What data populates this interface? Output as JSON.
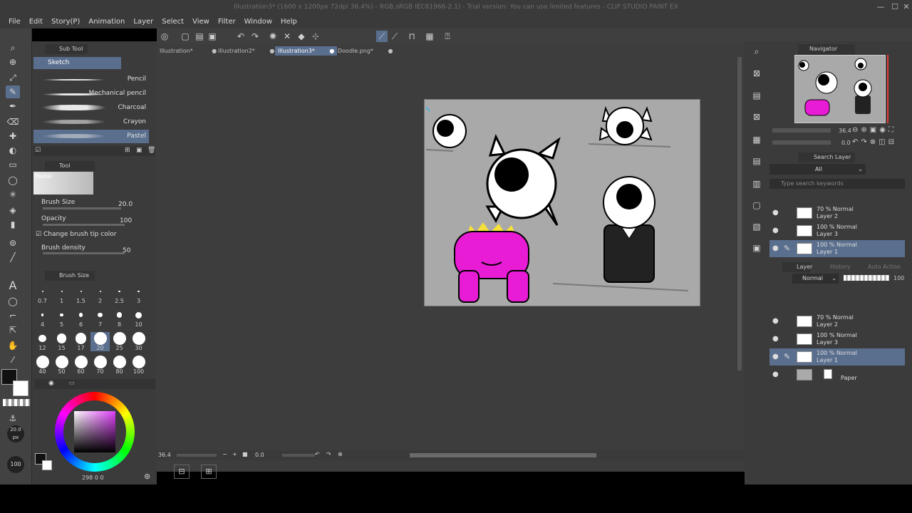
{
  "window": {
    "title": "Illustration3* (1600 x 1200px 72dpi 36.4%) - RGB,sRGB IEC61966-2.1) - Trial version: You can use limited features - CLIP STUDIO PAINT EX",
    "minimize": "—",
    "maximize": "☐",
    "close": "✕"
  },
  "menu": [
    "File",
    "Edit",
    "Story(P)",
    "Animation",
    "Layer",
    "Select",
    "View",
    "Filter",
    "Window",
    "Help"
  ],
  "tabs": [
    {
      "label": "Illustration*",
      "close": "●"
    },
    {
      "label": "Illustration2*",
      "close": "●"
    },
    {
      "label": "Illustration3*",
      "close": "●",
      "active": true
    },
    {
      "label": "Doodle.png*",
      "close": "●"
    }
  ],
  "subtool": {
    "title": "Sub Tool",
    "group": "Sketch",
    "brushes": [
      {
        "name": "Pencil"
      },
      {
        "name": "Mechanical pencil"
      },
      {
        "name": "Charcoal"
      },
      {
        "name": "Crayon"
      },
      {
        "name": "Pastel",
        "selected": true
      }
    ]
  },
  "toolprop": {
    "title": "Tool Property",
    "preview_label": "Pastel",
    "brush_size_label": "Brush Size",
    "brush_size_value": "20.0",
    "opacity_label": "Opacity",
    "opacity_value": "100",
    "change_tip_label": "Change brush tip color",
    "density_label": "Brush density",
    "density_value": "50"
  },
  "brushsize": {
    "title": "Brush Size",
    "sizes": [
      "0.7",
      "1",
      "1.5",
      "2",
      "2.5",
      "3",
      "4",
      "5",
      "6",
      "7",
      "8",
      "10",
      "12",
      "15",
      "17",
      "20",
      "25",
      "30",
      "40",
      "50",
      "60",
      "70",
      "80",
      "100"
    ],
    "selected": "20"
  },
  "sidebar_readouts": {
    "size": "20.0",
    "unit": "px",
    "opacity": "100"
  },
  "color": {
    "main": "#111111",
    "sub": "#ffffff",
    "bottom_readout": "298 0 0"
  },
  "canvas_status": {
    "zoom": "36.4",
    "angle": "0.0"
  },
  "navigator": {
    "title": "Navigator",
    "zoom": "36.4",
    "angle": "0.0"
  },
  "search_layer": {
    "title": "Search Layer",
    "filter": "All",
    "placeholder": "Type search keywords"
  },
  "layer_panel": {
    "tab_layer": "Layer",
    "tab_history": "History",
    "tab_auto": "Auto Action",
    "blend_mode": "Normal",
    "opacity": "100"
  },
  "layers_search": [
    {
      "line1": "70 % Normal",
      "line2": "Layer 2"
    },
    {
      "line1": "100 % Normal",
      "line2": "Layer 3"
    },
    {
      "line1": "100 % Normal",
      "line2": "Layer 1",
      "selected": true
    }
  ],
  "layers": [
    {
      "line1": "70 % Normal",
      "line2": "Layer 2"
    },
    {
      "line1": "100 % Normal",
      "line2": "Layer 3"
    },
    {
      "line1": "100 % Normal",
      "line2": "Layer 1",
      "selected": true
    },
    {
      "line1": "",
      "line2": "Paper",
      "paper": true
    }
  ],
  "icons": {
    "eye": "👁",
    "pen": "✎"
  }
}
